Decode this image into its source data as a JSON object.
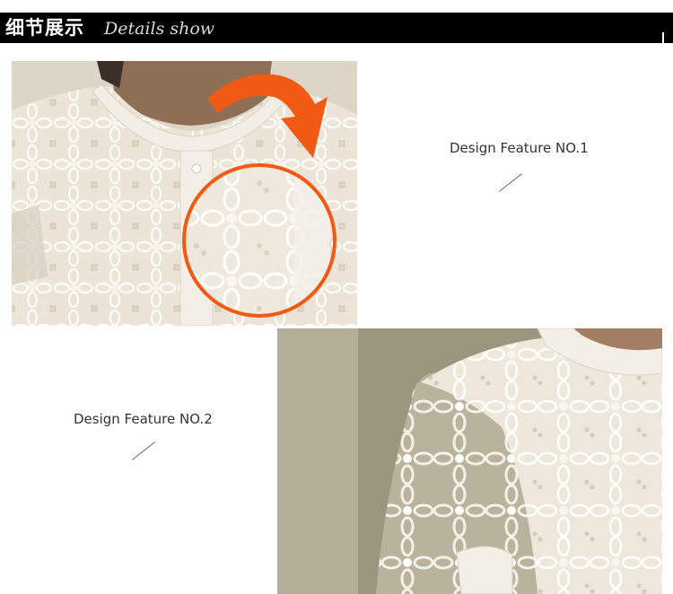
{
  "header": {
    "title_cn": "细节展示",
    "title_en": "Details show"
  },
  "features": [
    {
      "label": "Design Feature NO.1"
    },
    {
      "label": "Design Feature NO.2"
    }
  ],
  "colors": {
    "header_background": "#000000",
    "header_text": "#ffffff",
    "arrow_accent": "#f05a14",
    "lace_cream": "#efe8dc"
  }
}
